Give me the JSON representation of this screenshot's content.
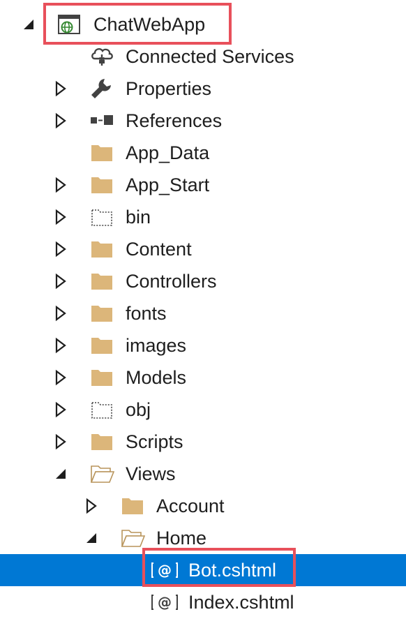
{
  "solution_explorer": {
    "project": {
      "label": "ChatWebApp",
      "expanded": true,
      "icon": "web-project-icon"
    },
    "items": [
      {
        "label": "Connected Services",
        "icon": "connected-services-icon",
        "expandable": false
      },
      {
        "label": "Properties",
        "icon": "wrench-icon",
        "expandable": true
      },
      {
        "label": "References",
        "icon": "references-icon",
        "expandable": true
      },
      {
        "label": "App_Data",
        "icon": "folder-icon",
        "expandable": false
      },
      {
        "label": "App_Start",
        "icon": "folder-icon",
        "expandable": true
      },
      {
        "label": "bin",
        "icon": "dotted-folder-icon",
        "expandable": true
      },
      {
        "label": "Content",
        "icon": "folder-icon",
        "expandable": true
      },
      {
        "label": "Controllers",
        "icon": "folder-icon",
        "expandable": true
      },
      {
        "label": "fonts",
        "icon": "folder-icon",
        "expandable": true
      },
      {
        "label": "images",
        "icon": "folder-icon",
        "expandable": true
      },
      {
        "label": "Models",
        "icon": "folder-icon",
        "expandable": true
      },
      {
        "label": "obj",
        "icon": "dotted-folder-icon",
        "expandable": true
      },
      {
        "label": "Scripts",
        "icon": "folder-icon",
        "expandable": true
      },
      {
        "label": "Views",
        "icon": "open-folder-icon",
        "expandable": true,
        "expanded": true
      },
      {
        "label": "Account",
        "icon": "folder-icon",
        "expandable": true
      },
      {
        "label": "Home",
        "icon": "open-folder-icon",
        "expandable": true,
        "expanded": true
      },
      {
        "label": "Bot.cshtml",
        "icon": "razor-file-icon",
        "selected": true
      },
      {
        "label": "Index.cshtml",
        "icon": "razor-file-icon"
      }
    ]
  },
  "colors": {
    "selection": "#0078d4",
    "highlight_border": "#e8505b",
    "folder": "#dcb67a",
    "text": "#1e1e1e",
    "web_globe": "#388a34"
  }
}
